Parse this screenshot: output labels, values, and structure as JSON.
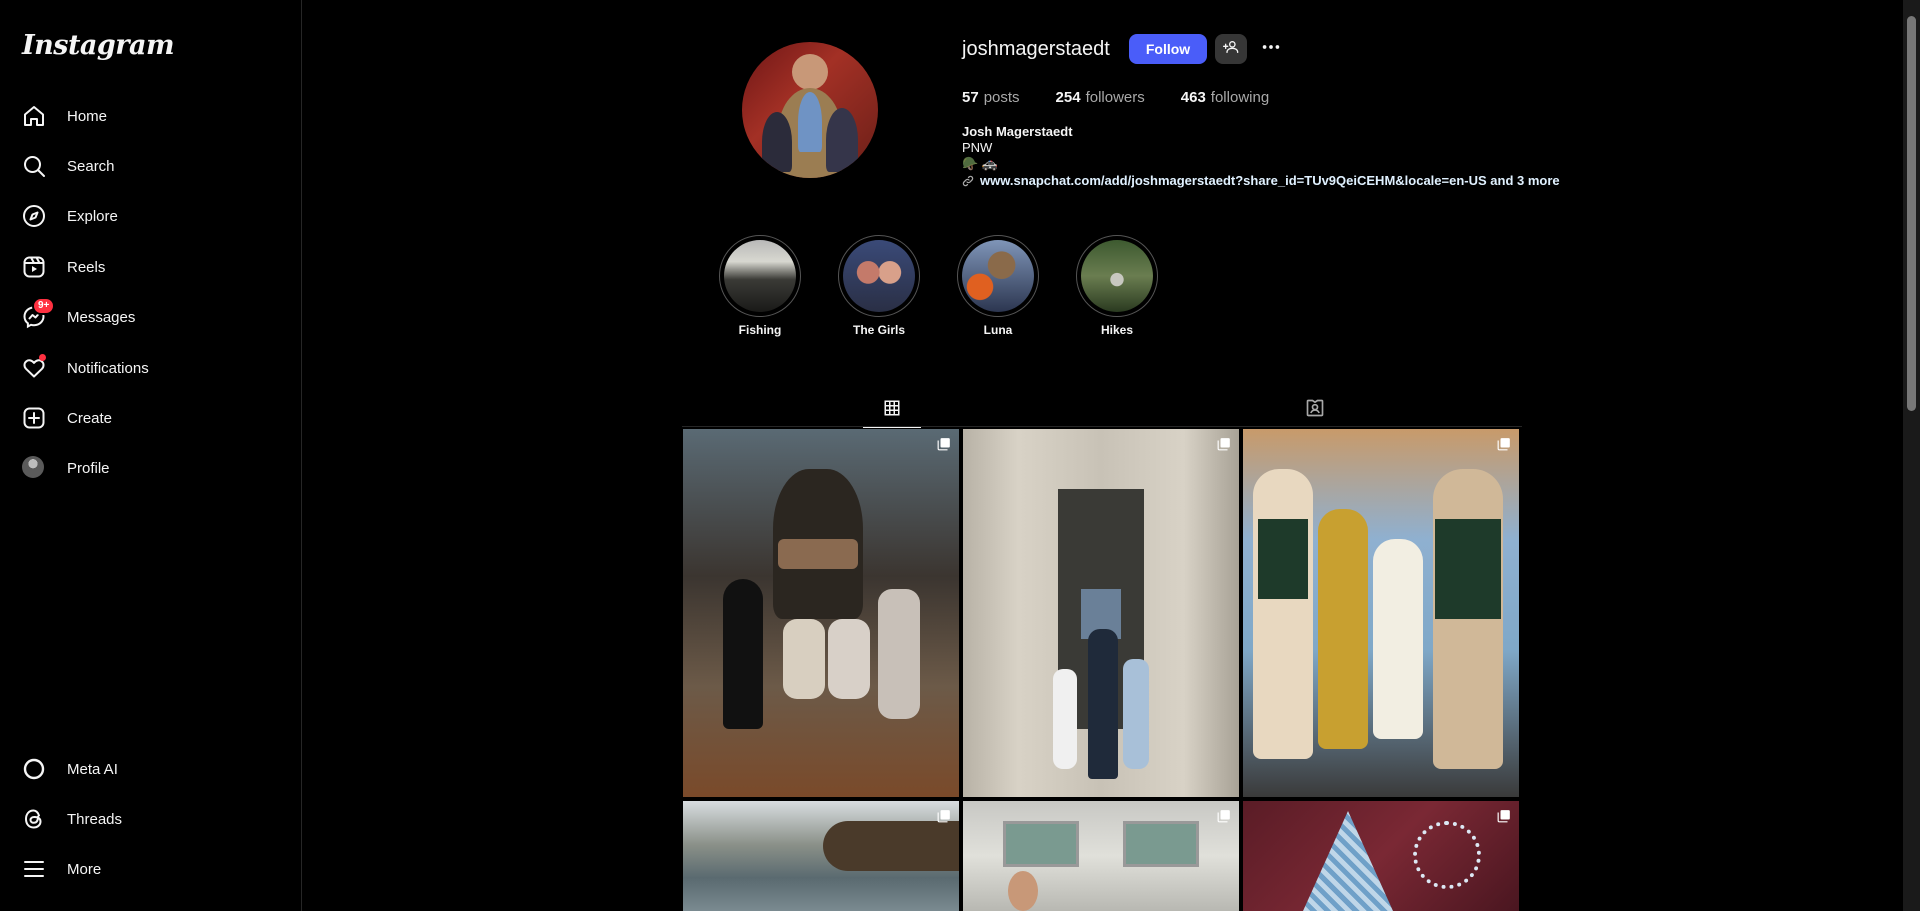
{
  "app": {
    "logo_text": "Instagram"
  },
  "nav": {
    "home": "Home",
    "search": "Search",
    "explore": "Explore",
    "reels": "Reels",
    "messages": "Messages",
    "messages_badge": "9+",
    "notifications": "Notifications",
    "create": "Create",
    "profile": "Profile",
    "meta_ai": "Meta AI",
    "threads": "Threads",
    "more": "More"
  },
  "profile": {
    "username": "joshmagerstaedt",
    "follow_label": "Follow",
    "posts_count": "57",
    "posts_label": "posts",
    "followers_count": "254",
    "followers_label": "followers",
    "following_count": "463",
    "following_label": "following",
    "full_name": "Josh Magerstaedt",
    "bio_line": "PNW",
    "bio_emoji": "🪖 🚓",
    "link_text": "www.snapchat.com/add/joshmagerstaedt?share_id=TUv9QeiCEHM&locale=en-US and 3 more"
  },
  "highlights": [
    {
      "label": "Fishing"
    },
    {
      "label": "The Girls"
    },
    {
      "label": "Luna"
    },
    {
      "label": "Hikes"
    }
  ],
  "tabs": {
    "posts": "grid-icon",
    "tagged": "tagged-icon"
  },
  "colors": {
    "accent": "#4a5df9",
    "badge": "#ff3040",
    "background": "#000000"
  }
}
